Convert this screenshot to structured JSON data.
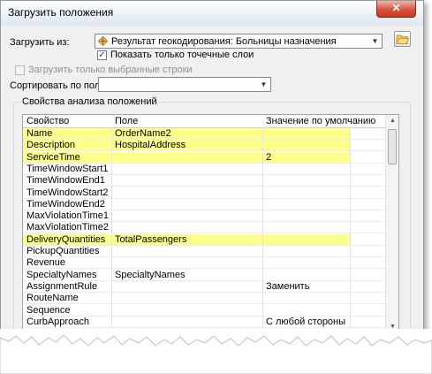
{
  "window": {
    "title": "Загрузить положения",
    "close_glyph": "✕"
  },
  "load_from": {
    "label": "Загрузить из:",
    "value": "Результат геокодирования: Больницы назначения",
    "icon": "geocode-diamond-icon"
  },
  "show_point_layers": {
    "label": "Показать только точечные слои",
    "checked": true
  },
  "load_selected": {
    "label": "Загрузить только выбранные строки",
    "checked": false,
    "enabled": false
  },
  "sort": {
    "label": "Сортировать по полю:",
    "value": ""
  },
  "properties": {
    "group_title": "Свойства анализа положений",
    "columns": [
      "Свойство",
      "Поле",
      "Значение по умолчанию"
    ],
    "rows": [
      {
        "property": "Name",
        "field": "OrderName2",
        "default": "",
        "highlight": true
      },
      {
        "property": "Description",
        "field": "HospitalAddress",
        "default": "",
        "highlight": true
      },
      {
        "property": "ServiceTime",
        "field": "",
        "default": "2",
        "highlight": true
      },
      {
        "property": "TimeWindowStart1",
        "field": "",
        "default": "",
        "highlight": false
      },
      {
        "property": "TimeWindowEnd1",
        "field": "",
        "default": "",
        "highlight": false
      },
      {
        "property": "TimeWindowStart2",
        "field": "",
        "default": "",
        "highlight": false
      },
      {
        "property": "TimeWindowEnd2",
        "field": "",
        "default": "",
        "highlight": false
      },
      {
        "property": "MaxViolationTime1",
        "field": "",
        "default": "",
        "highlight": false
      },
      {
        "property": "MaxViolationTime2",
        "field": "",
        "default": "",
        "highlight": false
      },
      {
        "property": "DeliveryQuantities",
        "field": "TotalPassengers",
        "default": "",
        "highlight": true
      },
      {
        "property": "PickupQuantities",
        "field": "",
        "default": "",
        "highlight": false
      },
      {
        "property": "Revenue",
        "field": "",
        "default": "",
        "highlight": false
      },
      {
        "property": "SpecialtyNames",
        "field": "SpecialtyNames",
        "default": "",
        "highlight": false
      },
      {
        "property": "AssignmentRule",
        "field": "",
        "default": "Заменить",
        "highlight": false
      },
      {
        "property": "RouteName",
        "field": "",
        "default": "",
        "highlight": false
      },
      {
        "property": "Sequence",
        "field": "",
        "default": "",
        "highlight": false
      },
      {
        "property": "CurbApproach",
        "field": "",
        "default": "С любой стороны",
        "highlight": false
      }
    ]
  },
  "colors": {
    "highlight": "#ffff8c",
    "close": "#d9533d"
  }
}
